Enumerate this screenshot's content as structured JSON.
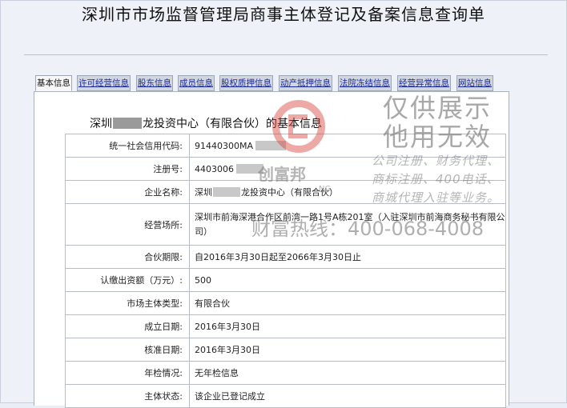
{
  "page": {
    "title": "深圳市市场监督管理局商事主体登记及备案信息查询单"
  },
  "tabs": [
    {
      "label": "基本信息",
      "active": true
    },
    {
      "label": "许可经营信息",
      "active": false
    },
    {
      "label": "股东信息",
      "active": false
    },
    {
      "label": "成员信息",
      "active": false
    },
    {
      "label": "股权质押信息",
      "active": false
    },
    {
      "label": "动产抵押信息",
      "active": false
    },
    {
      "label": "法院冻结信息",
      "active": false
    },
    {
      "label": "经营异常信息",
      "active": false
    },
    {
      "label": "网站信息",
      "active": false
    }
  ],
  "section": {
    "heading_prefix": "深圳",
    "heading_suffix": "龙投资中心（有限合伙）的基本信息"
  },
  "rows": [
    {
      "label": "统一社会信用代码:",
      "value": "91440300MA"
    },
    {
      "label": "注册号:",
      "value": "4403006"
    },
    {
      "label": "企业名称:",
      "value_prefix": "深圳",
      "value_suffix": "龙投资中心（有限合伙）"
    },
    {
      "label": "经营场所:",
      "value": "深圳市前海深港合作区前湾一路1号A栋201室（入驻深圳市前海商务秘书有限公司）"
    },
    {
      "label": "合伙期限:",
      "value": "自2016年3月30日起至2066年3月30日止"
    },
    {
      "label": "认缴出资额（万元）:",
      "value": "500"
    },
    {
      "label": "市场主体类型:",
      "value": "有限合伙"
    },
    {
      "label": "成立日期:",
      "value": "2016年3月30日"
    },
    {
      "label": "核准日期:",
      "value": "2016年3月30日"
    },
    {
      "label": "年检情况:",
      "value": "无年检信息"
    },
    {
      "label": "主体状态:",
      "value": "该企业已登记成立"
    }
  ],
  "watermark": {
    "line1": "仅供展示",
    "line2": "他用无效",
    "services": [
      "公司注册、财务代理、",
      "商标注册、400电话、",
      "商城代理入驻等业务。"
    ],
    "brand": "创富邦",
    "brand_en": "NG",
    "hotline": "财富热线：400-068-4008"
  },
  "colors": {
    "tab_link": "#1b2a9a",
    "logo_red": "#d6403a",
    "watermark_gray": "#8e8e8e"
  }
}
